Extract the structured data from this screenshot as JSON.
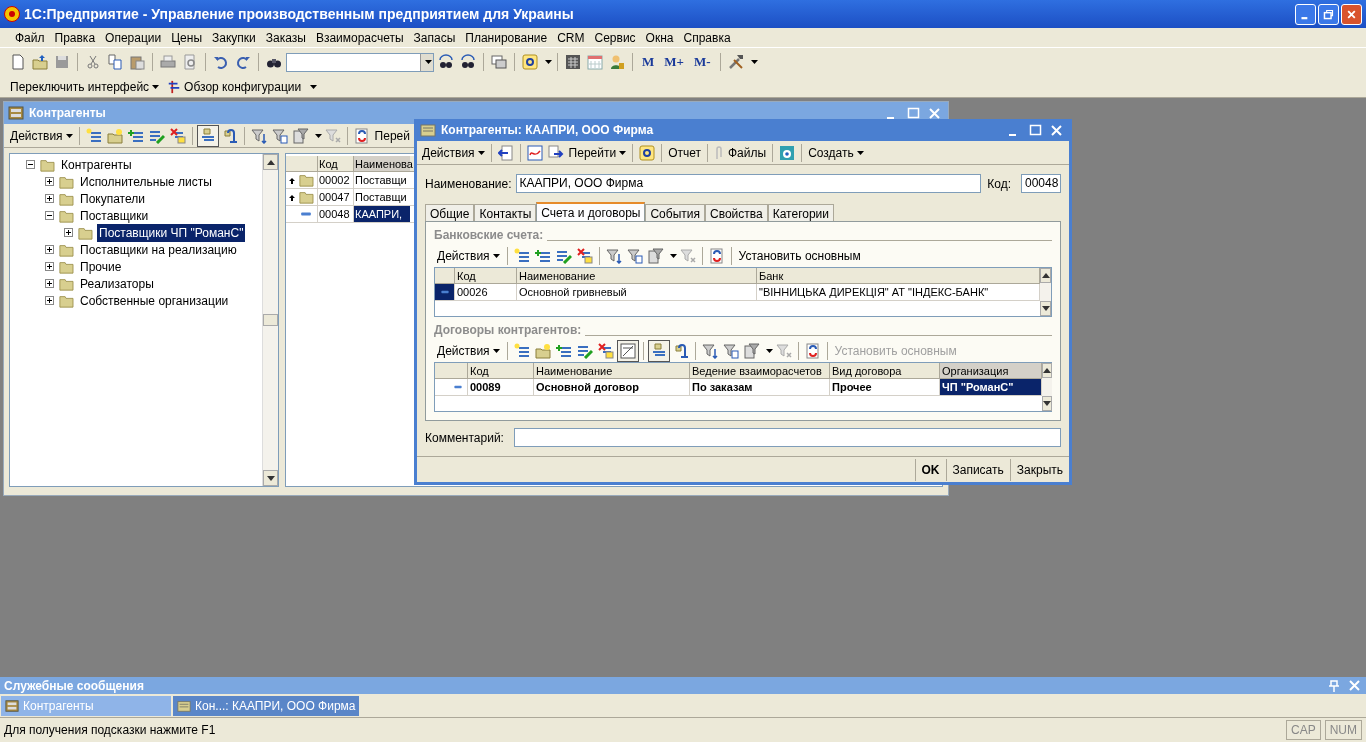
{
  "app_title": "1С:Предприятие - Управление производственным предприятием для Украины",
  "menu": [
    "Файл",
    "Правка",
    "Операции",
    "Цены",
    "Закупки",
    "Заказы",
    "Взаиморасчеты",
    "Запасы",
    "Планирование",
    "CRM",
    "Сервис",
    "Окна",
    "Справка"
  ],
  "memory_buttons": [
    "M",
    "M+",
    "M-"
  ],
  "toolbar2": [
    "Переключить интерфейс",
    "Обзор конфигурации"
  ],
  "catalog_window": {
    "title": "Контрагенты",
    "actions": "Действия",
    "goto": "Перей",
    "tree": [
      {
        "label": "Контрагенты",
        "expanded": true,
        "selected": false,
        "children": [
          {
            "label": "Исполнительные листы",
            "expanded": false,
            "selected": false
          },
          {
            "label": "Покупатели",
            "expanded": false,
            "selected": false
          },
          {
            "label": "Поставщики",
            "expanded": true,
            "selected": false,
            "children": [
              {
                "label": "Поставщики ЧП \"РоманС\"",
                "expanded": false,
                "selected": true
              }
            ]
          },
          {
            "label": "Поставщики на реализацию",
            "expanded": false,
            "selected": false
          },
          {
            "label": "Прочие",
            "expanded": false,
            "selected": false
          },
          {
            "label": "Реализаторы",
            "expanded": false,
            "selected": false
          },
          {
            "label": "Собственные организации",
            "expanded": false,
            "selected": false
          }
        ]
      }
    ],
    "list_columns": [
      "Код",
      "Наименова"
    ],
    "list_rows": [
      {
        "kind": "group",
        "code": "00002",
        "name": "Поставщи",
        "selected": false
      },
      {
        "kind": "group",
        "code": "00047",
        "name": "Поставщи",
        "selected": false
      },
      {
        "kind": "item",
        "code": "00048",
        "name": "КААПРИ,",
        "selected": true
      }
    ]
  },
  "dialog": {
    "title": "Контрагенты: КААПРИ, ООО Фирма",
    "toolbar": [
      "Действия",
      "Перейти",
      "Отчет",
      "Файлы",
      "Создать"
    ],
    "name_label": "Наименование:",
    "name_value": "КААПРИ, ООО Фирма",
    "code_label": "Код:",
    "code_value": "00048",
    "tabs": [
      {
        "label": "Общие",
        "selected": false
      },
      {
        "label": "Контакты",
        "selected": false
      },
      {
        "label": "Счета и договоры",
        "selected": true
      },
      {
        "label": "События",
        "selected": false
      },
      {
        "label": "Свойства",
        "selected": false
      },
      {
        "label": "Категории",
        "selected": false
      }
    ],
    "bank_accounts": {
      "title": "Банковские счета:",
      "actions": "Действия",
      "set_main": {
        "label": "Установить основным",
        "disabled": false
      },
      "columns": [
        "Код",
        "Наименование",
        "Банк"
      ],
      "rows": [
        {
          "selected": true,
          "bold": false,
          "cells": [
            {
              "text": "00026",
              "selected": false
            },
            {
              "text": "Основной гривневый",
              "selected": false
            },
            {
              "text": "\"ВІННИЦЬКА ДИРЕКЦІЯ\" АТ \"ІНДЕКС-БАНК\"",
              "selected": false
            }
          ]
        }
      ]
    },
    "contracts": {
      "title": "Договоры контрагентов:",
      "actions": "Действия",
      "set_main": {
        "label": "Установить основным",
        "disabled": true
      },
      "columns": [
        "Код",
        "Наименование",
        "Ведение взаиморасчетов",
        "Вид договора",
        "Организация"
      ],
      "rows": [
        {
          "selected": false,
          "bold": true,
          "cells": [
            {
              "text": "00089",
              "selected": false
            },
            {
              "text": "Основной договор",
              "selected": false
            },
            {
              "text": "По заказам",
              "selected": false
            },
            {
              "text": "Прочее",
              "selected": false
            },
            {
              "text": "ЧП \"РоманС\"",
              "selected": true
            }
          ]
        }
      ]
    },
    "comment_label": "Комментарий:",
    "buttons": [
      {
        "label": "OK",
        "default": true
      },
      {
        "label": "Записать",
        "default": false
      },
      {
        "label": "Закрыть",
        "default": false
      }
    ]
  },
  "messages_panel": "Служебные сообщения",
  "taskbar": [
    {
      "label": "Контрагенты",
      "selected": false
    },
    {
      "label": "Кон...: КААПРИ, ООО Фирма",
      "selected": true
    }
  ],
  "status": {
    "hint": "Для получения подсказки нажмите F1",
    "indicators": [
      "CAP",
      "NUM"
    ]
  }
}
